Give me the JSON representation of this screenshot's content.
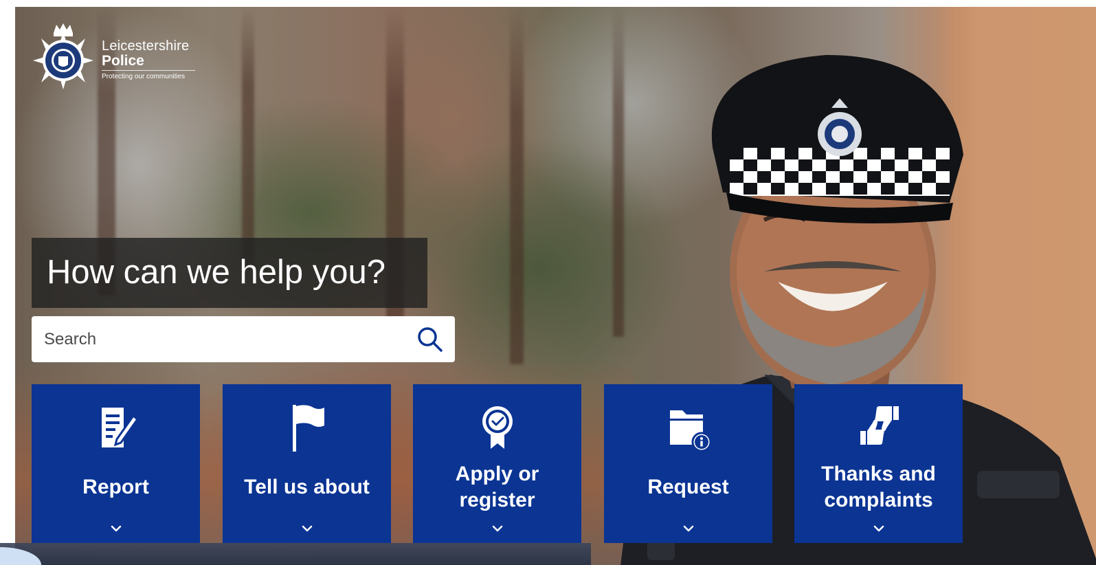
{
  "brand": {
    "name_line1": "Leicestershire",
    "name_line2": "Police",
    "tagline": "Protecting our communities",
    "badge_text": "LEICESTERSHIRE POLICE"
  },
  "hero": {
    "heading": "How can we help you?"
  },
  "search": {
    "placeholder": "Search",
    "icon": "search-icon"
  },
  "tiles": [
    {
      "label": "Report",
      "icon": "report-form-icon"
    },
    {
      "label": "Tell us about",
      "icon": "flag-icon"
    },
    {
      "label": "Apply or register",
      "icon": "award-ribbon-icon"
    },
    {
      "label": "Request",
      "icon": "folder-info-icon"
    },
    {
      "label": "Thanks and complaints",
      "icon": "thumbs-up-down-icon"
    }
  ],
  "colors": {
    "tile_blue": "#0b3493",
    "heading_box": "#222222",
    "search_icon": "#0b3493"
  }
}
